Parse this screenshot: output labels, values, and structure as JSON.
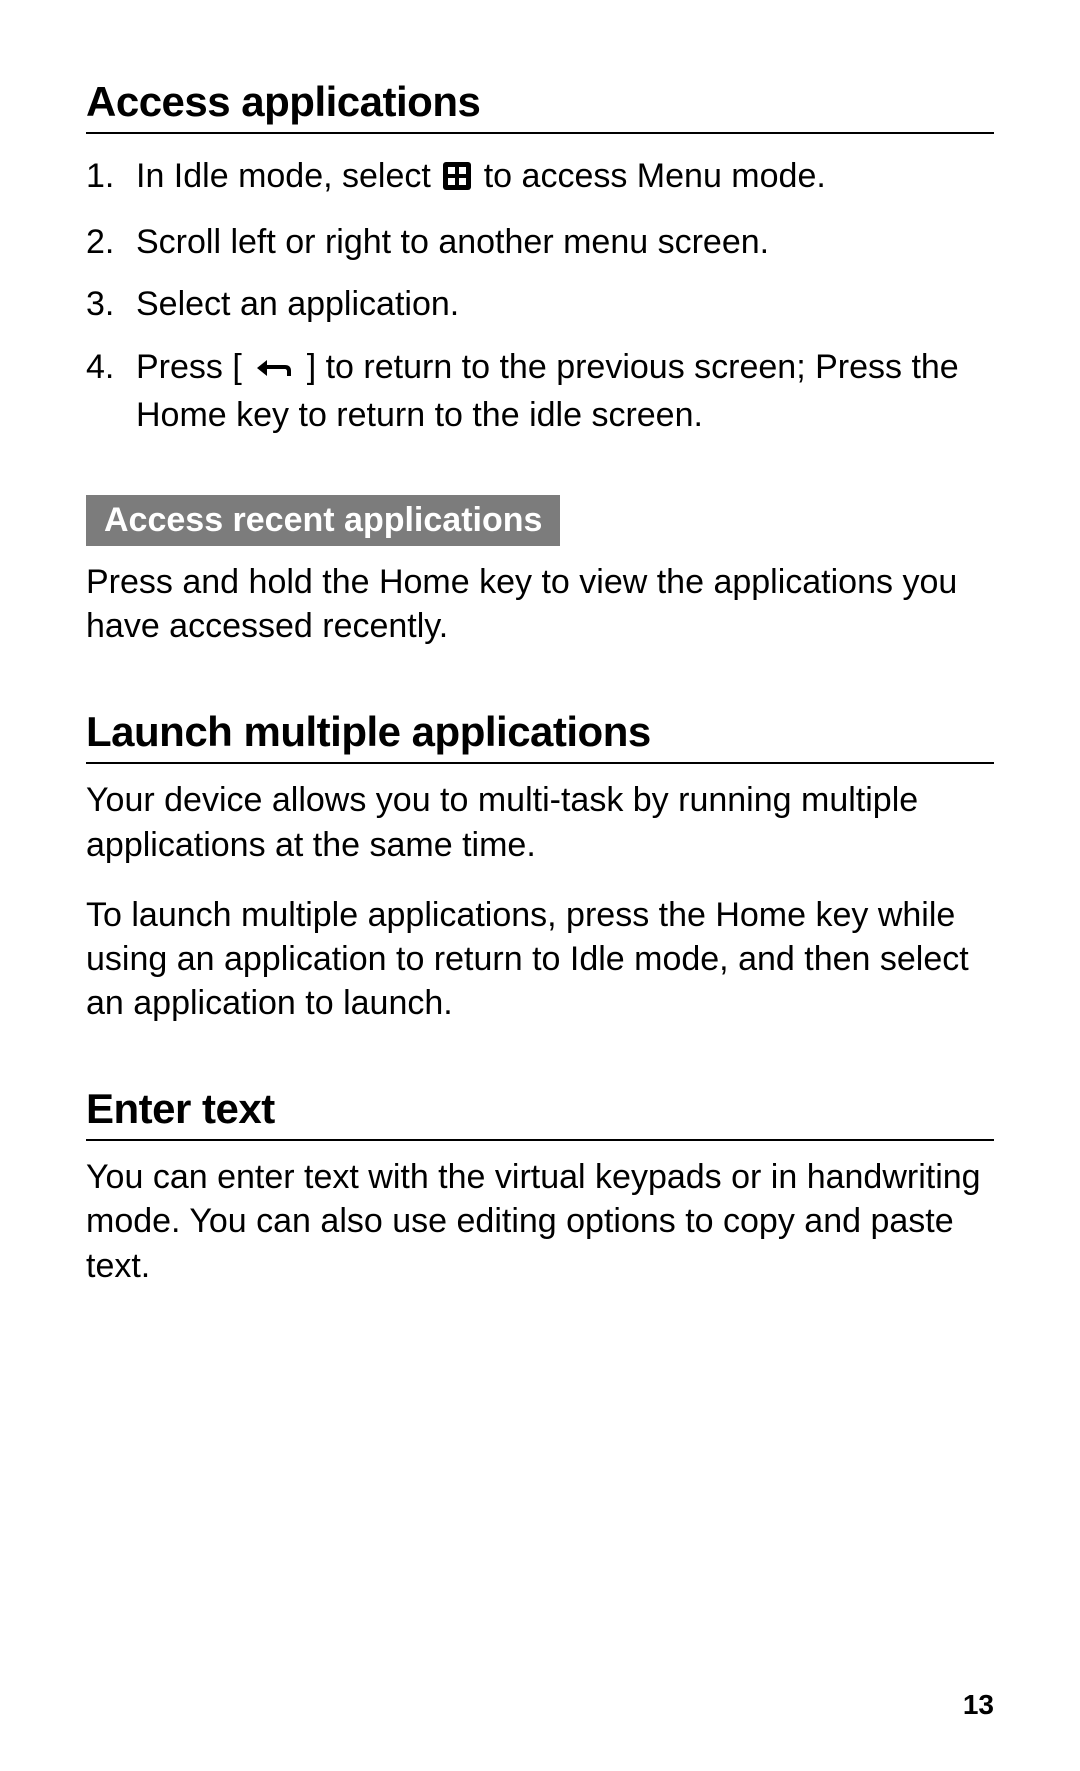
{
  "section1": {
    "heading": "Access applications",
    "steps": {
      "s1a": "In Idle mode, select ",
      "s1b": " to access Menu mode.",
      "s2": "Scroll left or right to another menu screen.",
      "s3": "Select an application.",
      "s4a": "Press [",
      "s4b": "] to return to the previous screen; Press the Home key to return to the idle screen."
    },
    "sub_heading": "Access recent applications",
    "sub_text": "Press and hold the Home key to view the applications you have accessed recently."
  },
  "section2": {
    "heading": "Launch multiple applications",
    "p1": "Your device allows you to multi-task by running multiple applications at the same time.",
    "p2": "To launch multiple applications, press the Home key while using an application to return to Idle mode, and then select an application to launch."
  },
  "section3": {
    "heading": "Enter text",
    "p1": "You can enter text with the virtual keypads or in handwriting mode. You can also use editing options to copy and paste text."
  },
  "page_number": "13"
}
